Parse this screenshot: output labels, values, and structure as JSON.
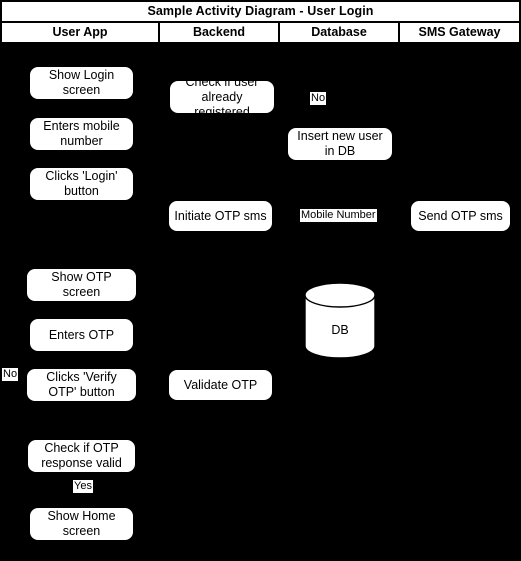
{
  "diagram": {
    "title": "Sample Activity Diagram - User Login",
    "background_color": "#000000",
    "node_fill_color": "#ffffff",
    "text_color": "#000000",
    "lanes": [
      {
        "label": "User App"
      },
      {
        "label": "Backend"
      },
      {
        "label": "Database"
      },
      {
        "label": "SMS Gateway"
      }
    ],
    "nodes": [
      {
        "id": "show-login-screen",
        "lane": "User App",
        "text": "Show Login screen"
      },
      {
        "id": "enters-mobile-number",
        "lane": "User App",
        "text": "Enters mobile number"
      },
      {
        "id": "clicks-login-button",
        "lane": "User App",
        "text": "Clicks 'Login' button"
      },
      {
        "id": "show-otp-screen",
        "lane": "User App",
        "text": "Show OTP screen"
      },
      {
        "id": "enters-otp",
        "lane": "User App",
        "text": "Enters OTP"
      },
      {
        "id": "clicks-verify-otp",
        "lane": "User App",
        "text": "Clicks 'Verify OTP' button"
      },
      {
        "id": "check-otp-response",
        "lane": "User App",
        "text": "Check if OTP response valid"
      },
      {
        "id": "show-home-screen",
        "lane": "User App",
        "text": "Show Home screen"
      },
      {
        "id": "check-if-registered",
        "lane": "Backend",
        "text": "Check if user already registered"
      },
      {
        "id": "initiate-otp-sms",
        "lane": "Backend",
        "text": "Initiate OTP sms"
      },
      {
        "id": "validate-otp",
        "lane": "Backend",
        "text": "Validate OTP"
      },
      {
        "id": "insert-new-user",
        "lane": "Database",
        "text": "Insert new user in DB"
      },
      {
        "id": "send-otp-sms",
        "lane": "SMS Gateway",
        "text": "Send OTP sms"
      }
    ],
    "edge_labels": [
      {
        "id": "no-registered",
        "text": "No"
      },
      {
        "id": "mobile-number",
        "text": "Mobile Number"
      },
      {
        "id": "no-otp-invalid",
        "text": "No"
      },
      {
        "id": "yes-otp-valid",
        "text": "Yes"
      }
    ],
    "datastore": {
      "id": "db-cylinder",
      "label": "DB"
    }
  }
}
